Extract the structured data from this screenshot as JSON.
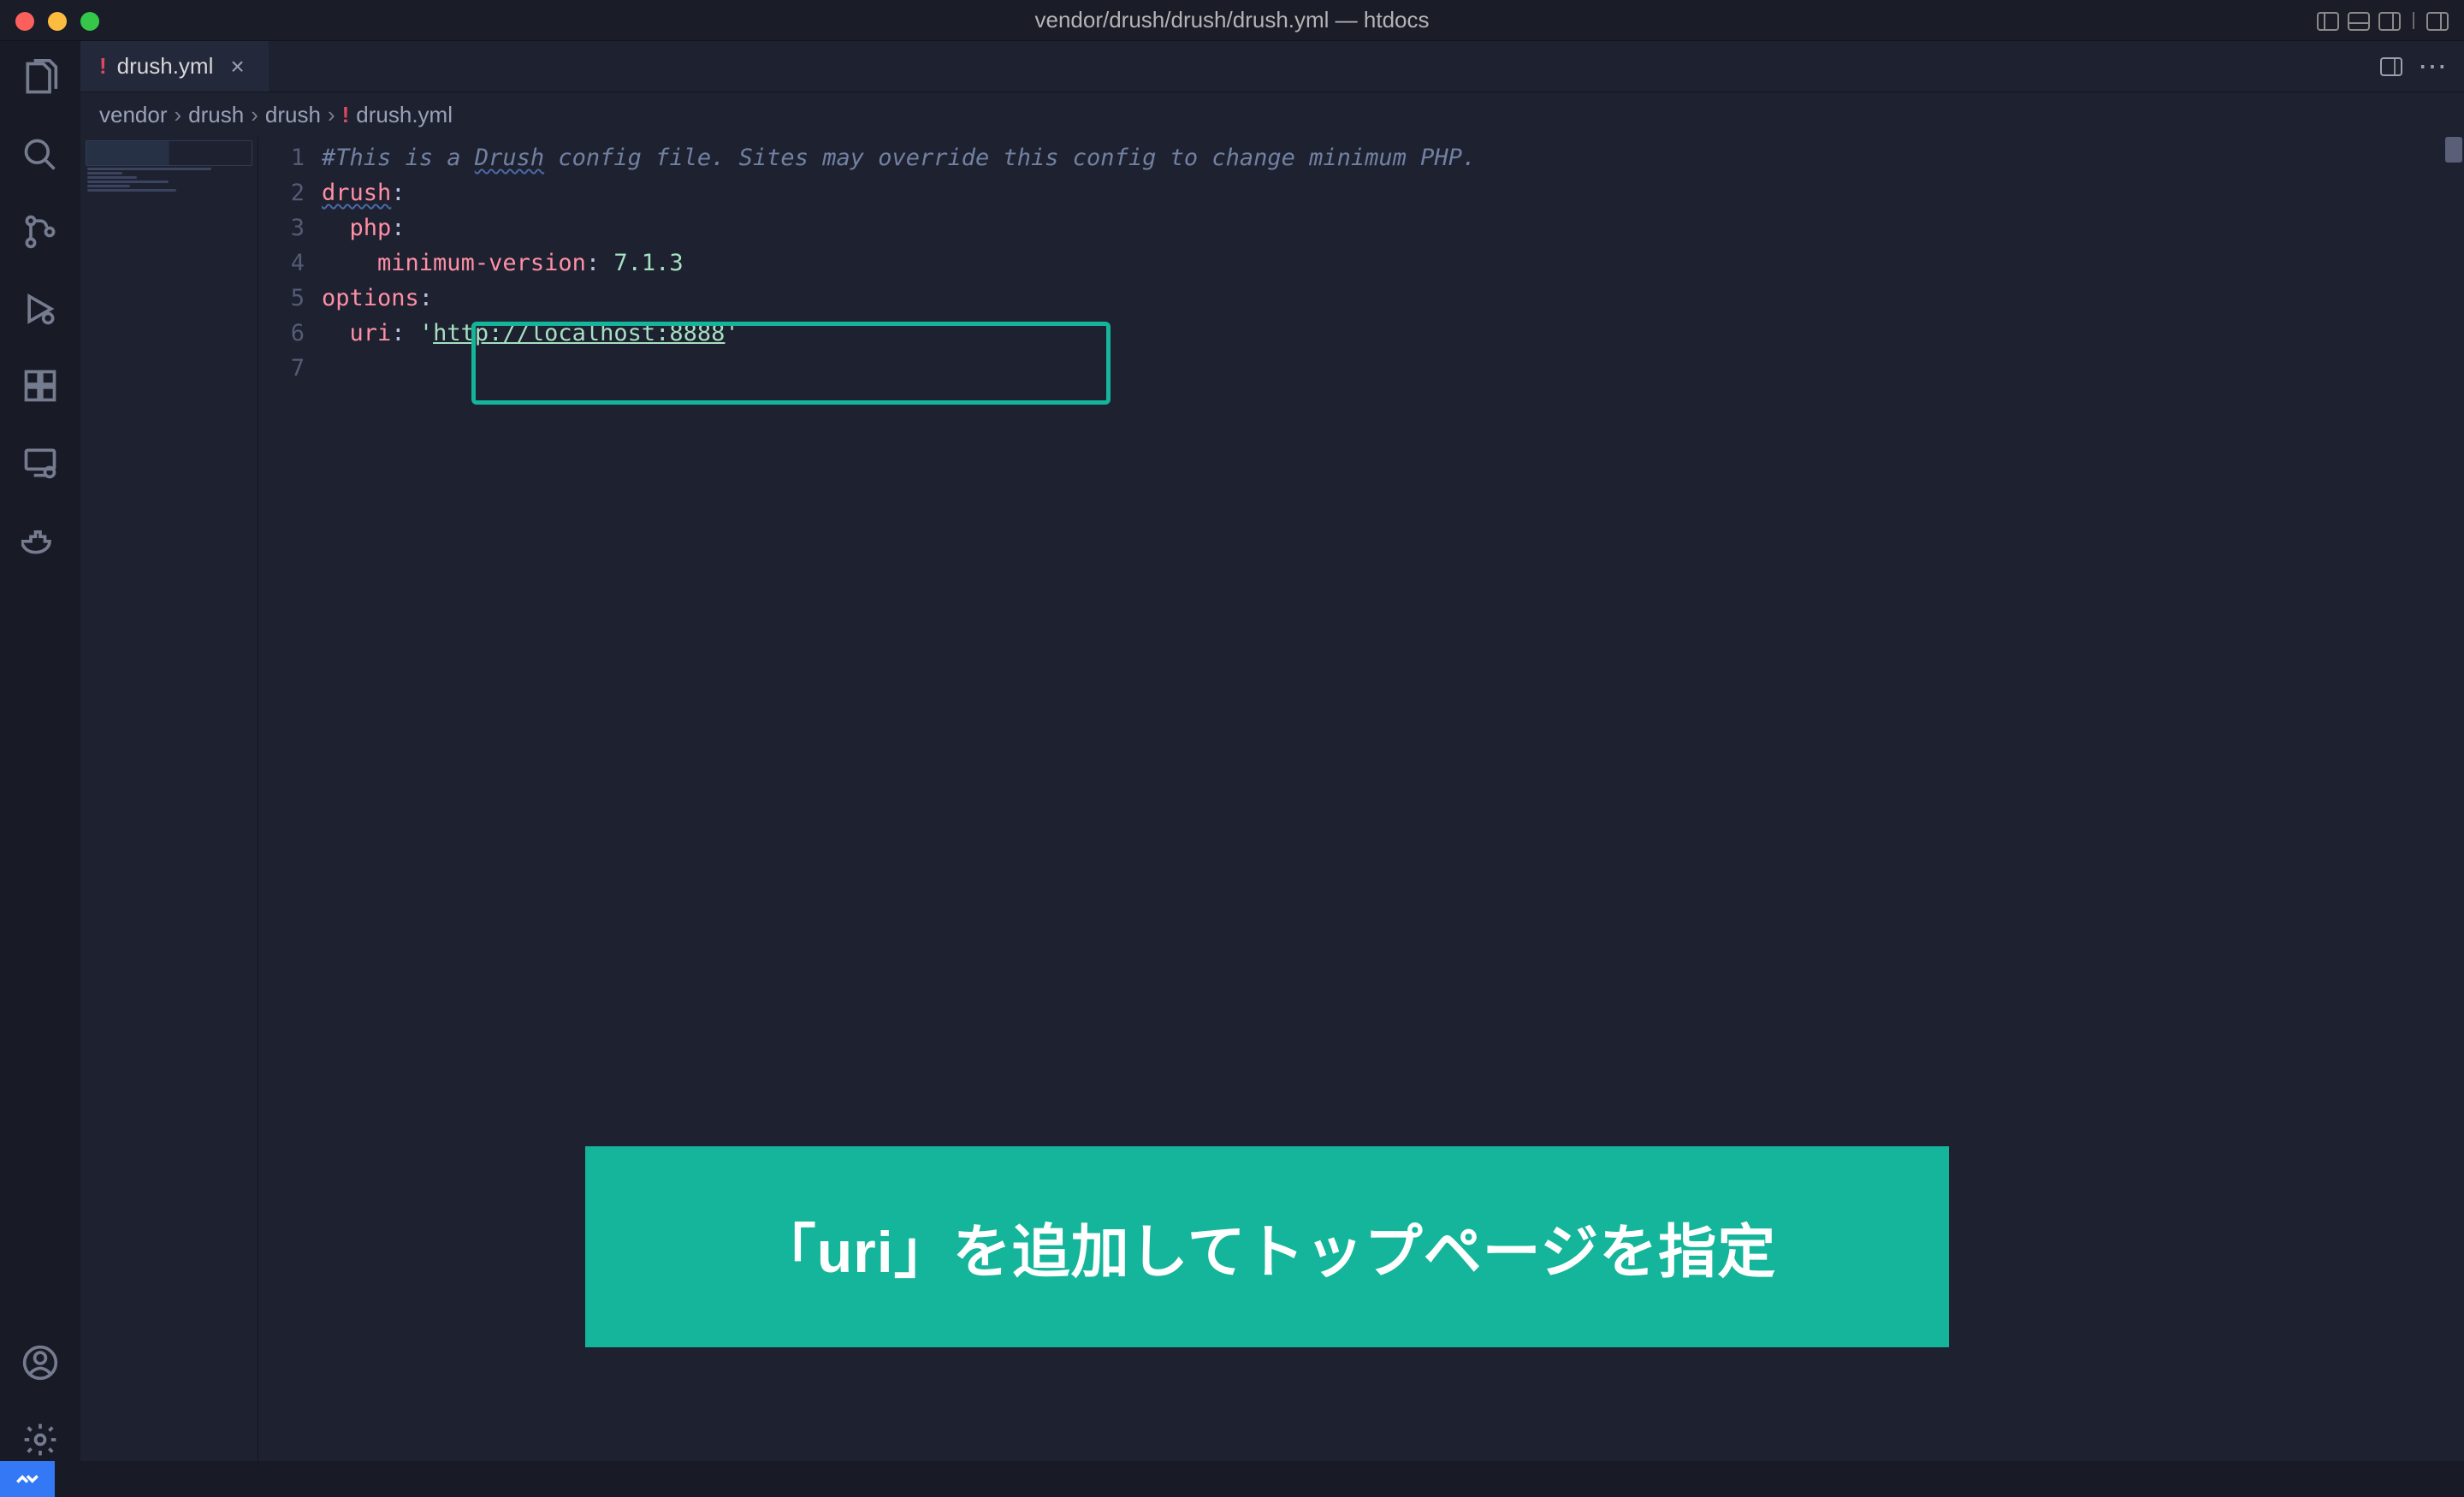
{
  "window_title": "vendor/drush/drush/drush.yml — htdocs",
  "tab": {
    "label": "drush.yml",
    "modified": true
  },
  "breadcrumb": [
    "vendor",
    "drush",
    "drush",
    "drush.yml"
  ],
  "gutter": [
    "1",
    "2",
    "3",
    "4",
    "5",
    "6",
    "7"
  ],
  "code": {
    "l1_a": "#This is a ",
    "l1_b": "Drush",
    "l1_c": " config file. Sites may override this config to change minimum PHP.",
    "l2_key": "drush",
    "l3_key": "php",
    "l4_key": "minimum-version",
    "l4_val": " 7.1.3",
    "l5_key": "options",
    "l6_key": "uri",
    "l6_q": " '",
    "l6_url": "http://localhost:8888",
    "l6_q2": "'"
  },
  "banner": "「uri」を追加してトップページを指定"
}
